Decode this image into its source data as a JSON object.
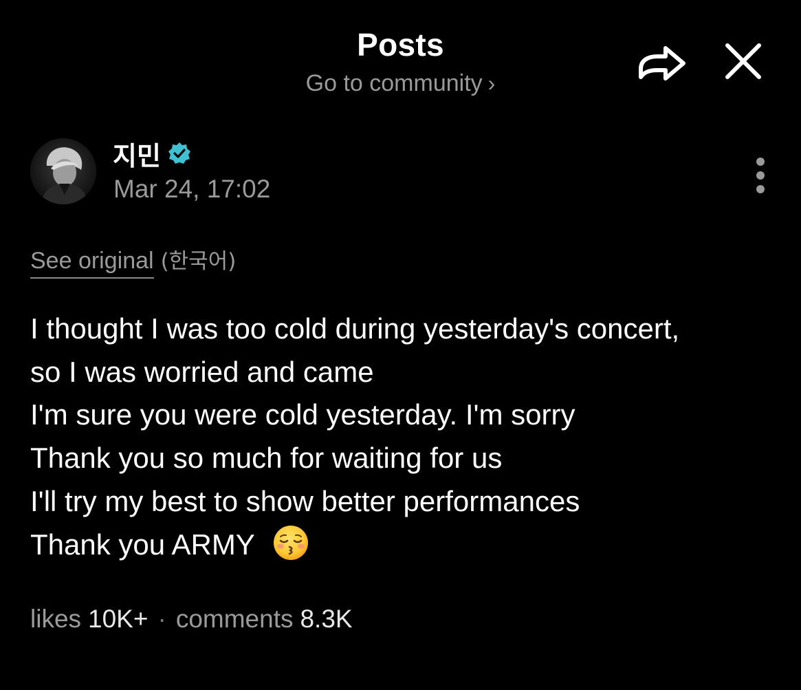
{
  "header": {
    "title": "Posts",
    "community_link": "Go to community",
    "chevron": "›"
  },
  "actions": {
    "share_icon": "share-arrow-icon",
    "close_icon": "close-x-icon",
    "more_icon": "vertical-dots-icon"
  },
  "author": {
    "name": "지민",
    "verified": true,
    "verified_color": "#3ec1d3",
    "timestamp": "Mar 24, 17:02"
  },
  "translation": {
    "see_original": "See original",
    "language": "(한국어)"
  },
  "post": {
    "lines": [
      "I thought I was too cold during yesterday's concert,",
      "so I was worried and came",
      "I'm sure you were cold yesterday. I'm sorry",
      "Thank you so much for waiting for us",
      "I'll try my best to show better performances",
      "Thank you ARMY"
    ],
    "emoji": "kissing-face-with-closed-eyes-emoji"
  },
  "stats": {
    "likes_label": "likes",
    "likes_value": "10K+",
    "separator": "·",
    "comments_label": "comments",
    "comments_value": "8.3K"
  },
  "colors": {
    "background": "#000000",
    "primary_text": "#ffffff",
    "secondary_text": "#9a9a9a"
  }
}
